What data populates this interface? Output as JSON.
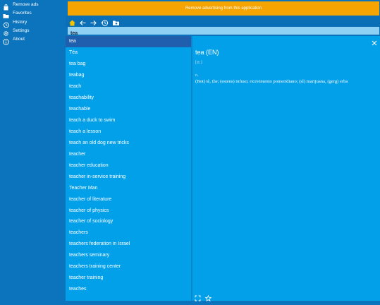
{
  "sidebar": {
    "items": [
      {
        "label": "Remove ads",
        "icon": "bag-icon"
      },
      {
        "label": "Favorites",
        "icon": "folder-icon"
      },
      {
        "label": "History",
        "icon": "history-icon"
      },
      {
        "label": "Settings",
        "icon": "gear-icon"
      },
      {
        "label": "About",
        "icon": "info-icon"
      }
    ]
  },
  "ad_banner": {
    "text": "Remove advertising from this application"
  },
  "toolbar": {
    "buttons": [
      "home-icon",
      "back-arrow-icon",
      "forward-arrow-icon",
      "history-icon",
      "folder-icon"
    ]
  },
  "search": {
    "value": "tea"
  },
  "word_list": {
    "selected": "tea",
    "items": [
      "tea",
      "Téa",
      "tea bag",
      "teabag",
      "teach",
      "teachability",
      "teachable",
      "teach a duck to swim",
      "teach a lesson",
      "teach an old dog new tricks",
      "teacher",
      "teacher education",
      "teacher in-service training",
      "Teacher Man",
      "teacher of literature",
      "teacher of physics",
      "teacher of sociology",
      "teachers",
      "teachers federation in Israel",
      "teachers seminary",
      "teachers training center",
      "teacher training",
      "teaches"
    ]
  },
  "entry": {
    "title": "tea (EN)",
    "pronunciation": "[tiː]",
    "part_of_speech": "n.",
    "definition": "(Bot) tè, the; (estens) infuso; ricevimento pomeridiano; (sl) marijuana, (gerg) erba"
  },
  "detail_buttons": [
    "fullscreen-icon",
    "star-icon",
    "close-icon"
  ],
  "colors": {
    "accent": "#03a0ea",
    "sidebar": "#0b74bd",
    "banner": "#f5a400",
    "selected": "#1f5fad",
    "search": "#8fd0f5"
  }
}
